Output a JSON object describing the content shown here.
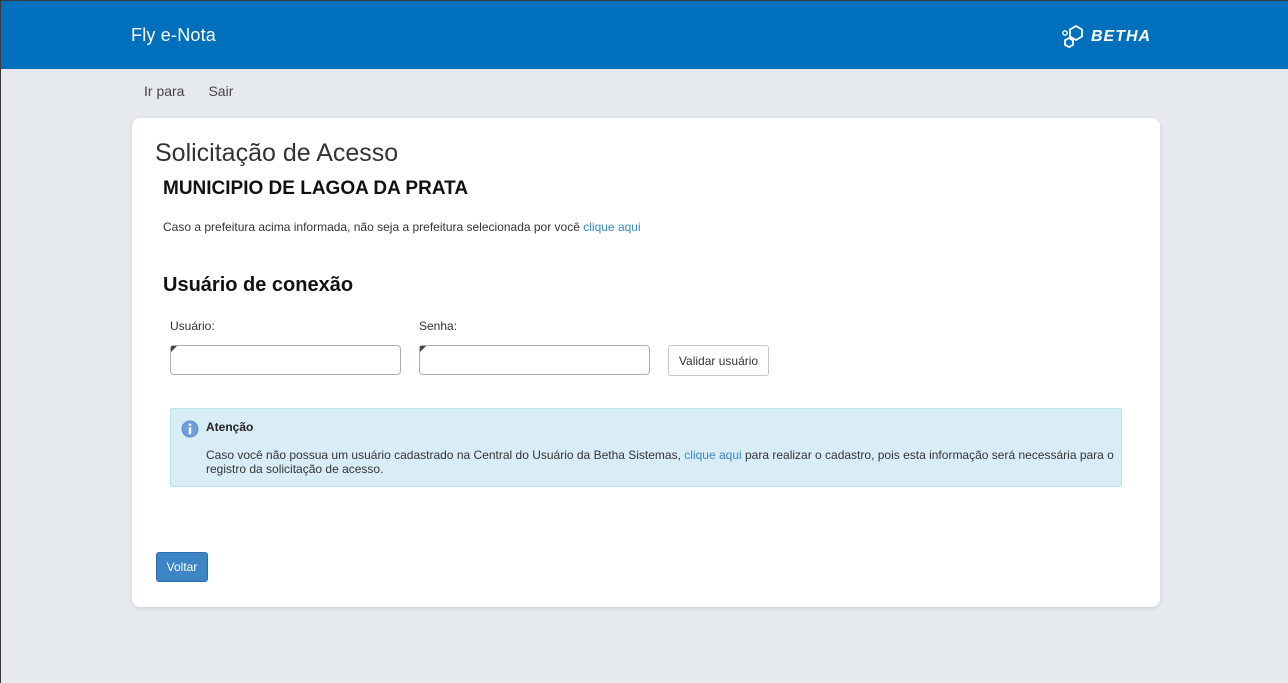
{
  "header": {
    "app_title": "Fly e-Nota",
    "brand": "BETHA",
    "brand_icon": "hexagon-logo-icon",
    "background_color": "#0070bd"
  },
  "nav": {
    "items": [
      {
        "label": "Ir para"
      },
      {
        "label": "Sair"
      }
    ]
  },
  "main": {
    "title": "Solicitação de Acesso",
    "municipality": "MUNICIPIO DE LAGOA DA PRATA",
    "notice_text": "Caso a prefeitura acima informada, não seja a prefeitura selecionada por você",
    "notice_link": "clique aqui",
    "section_title": "Usuário de conexão",
    "form": {
      "user_label": "Usuário:",
      "user_value": "",
      "password_label": "Senha:",
      "password_value": "",
      "validate_button": "Validar usuário"
    },
    "alert": {
      "icon": "info-icon",
      "title": "Atenção",
      "text_before": "Caso você não possua um usuário cadastrado na Central do Usuário da Betha Sistemas,",
      "link": "clique aqui",
      "text_after": "para realizar o cadastro, pois esta informação será necessária para o registro da solicitação de acesso.",
      "background_color": "#d9edf7"
    },
    "back_button": "Voltar",
    "link_color": "#3a87c8",
    "primary_button_color": "#3d86c6"
  }
}
